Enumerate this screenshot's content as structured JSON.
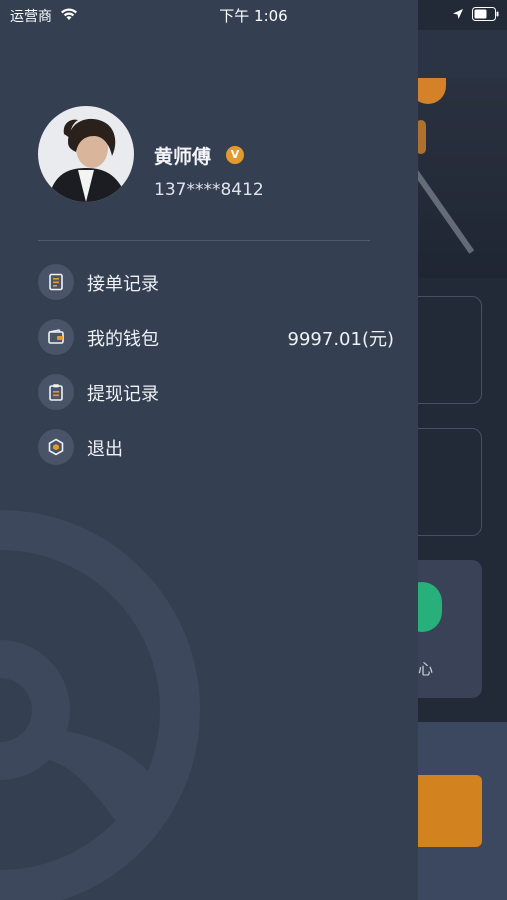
{
  "status_bar": {
    "carrier": "运营商",
    "time": "下午 1:06"
  },
  "profile": {
    "name": "黄师傅",
    "verified_badge": "V",
    "phone": "137****8412"
  },
  "menu": {
    "items": [
      {
        "label": "接单记录",
        "icon": "order-record-icon"
      },
      {
        "label": "我的钱包",
        "icon": "wallet-icon",
        "value": "9997.01(元)"
      },
      {
        "label": "提现记录",
        "icon": "withdraw-record-icon"
      },
      {
        "label": "退出",
        "icon": "logout-icon"
      }
    ]
  },
  "background": {
    "tile_label": "心"
  },
  "colors": {
    "drawer_bg": "#353f52",
    "accent_orange": "#e39a2d",
    "accent_green": "#27b07a"
  }
}
